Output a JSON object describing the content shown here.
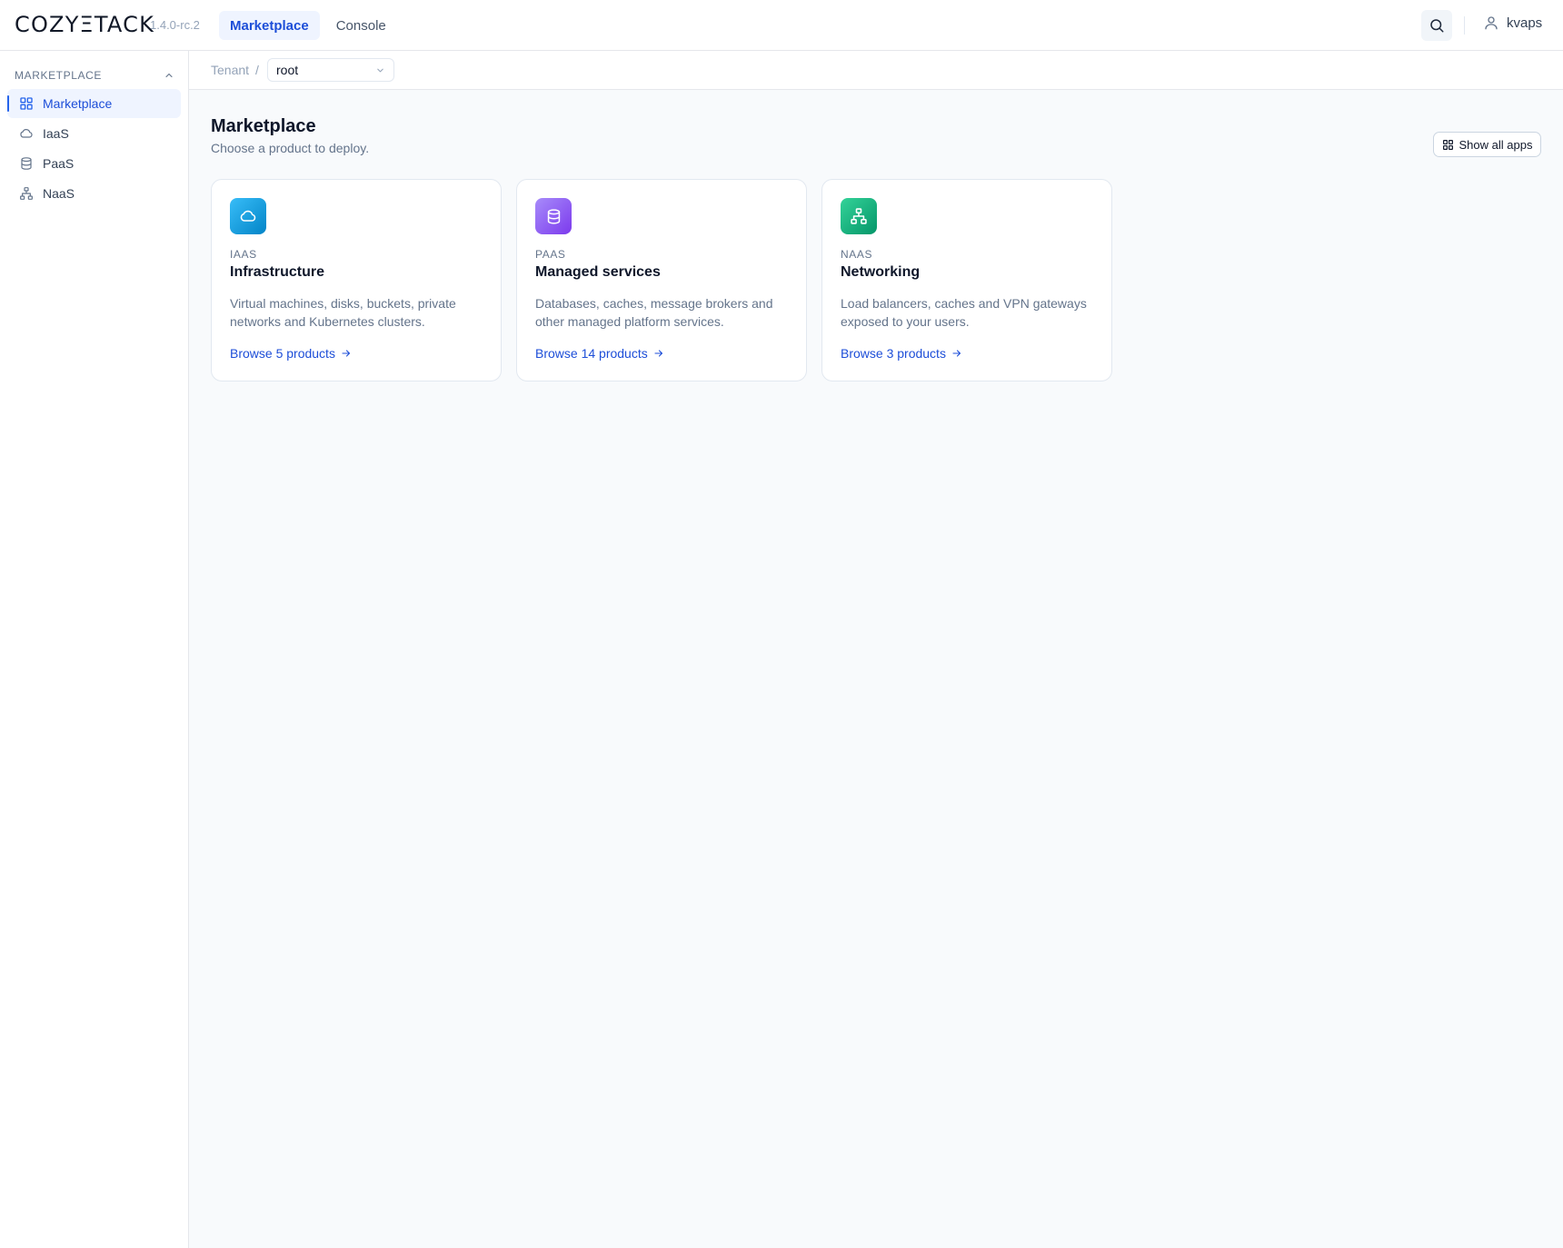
{
  "header": {
    "logo": "COZYΞTACK",
    "version": "1.4.0-rc.2",
    "nav": [
      {
        "label": "Marketplace",
        "active": true
      },
      {
        "label": "Console",
        "active": false
      }
    ],
    "search_icon": "search-icon",
    "user": {
      "name": "kvaps",
      "icon": "user-icon"
    }
  },
  "sidebar": {
    "section_title": "MARKETPLACE",
    "section_icon": "chevron-up-icon",
    "items": [
      {
        "label": "Marketplace",
        "icon": "grid-icon",
        "active": true
      },
      {
        "label": "IaaS",
        "icon": "cloud-icon",
        "active": false
      },
      {
        "label": "PaaS",
        "icon": "database-icon",
        "active": false
      },
      {
        "label": "NaaS",
        "icon": "network-icon",
        "active": false
      }
    ]
  },
  "breadcrumb": {
    "tenant_label": "Tenant",
    "separator": "/",
    "tenant_value": "root"
  },
  "main": {
    "title": "Marketplace",
    "subtitle": "Choose a product to deploy.",
    "show_all_label": "Show all apps",
    "cards": [
      {
        "tag": "IAAS",
        "title": "Infrastructure",
        "description": "Virtual machines, disks, buckets, private networks and Kubernetes clusters.",
        "link": "Browse 5 products",
        "icon": "cloud-icon",
        "color_from": "#38bdf8",
        "color_to": "#0284c7"
      },
      {
        "tag": "PAAS",
        "title": "Managed services",
        "description": "Databases, caches, message brokers and other managed platform services.",
        "link": "Browse 14 products",
        "icon": "database-icon",
        "color_from": "#a78bfa",
        "color_to": "#7c3aed"
      },
      {
        "tag": "NAAS",
        "title": "Networking",
        "description": "Load balancers, caches and VPN gateways exposed to your users.",
        "link": "Browse 3 products",
        "icon": "network-icon",
        "color_from": "#34d399",
        "color_to": "#059669"
      }
    ]
  },
  "colors": {
    "accent": "#1d4ed8",
    "active_bg": "#eff4ff",
    "page_bg": "#f8fafc",
    "border": "#e2e8f0"
  }
}
